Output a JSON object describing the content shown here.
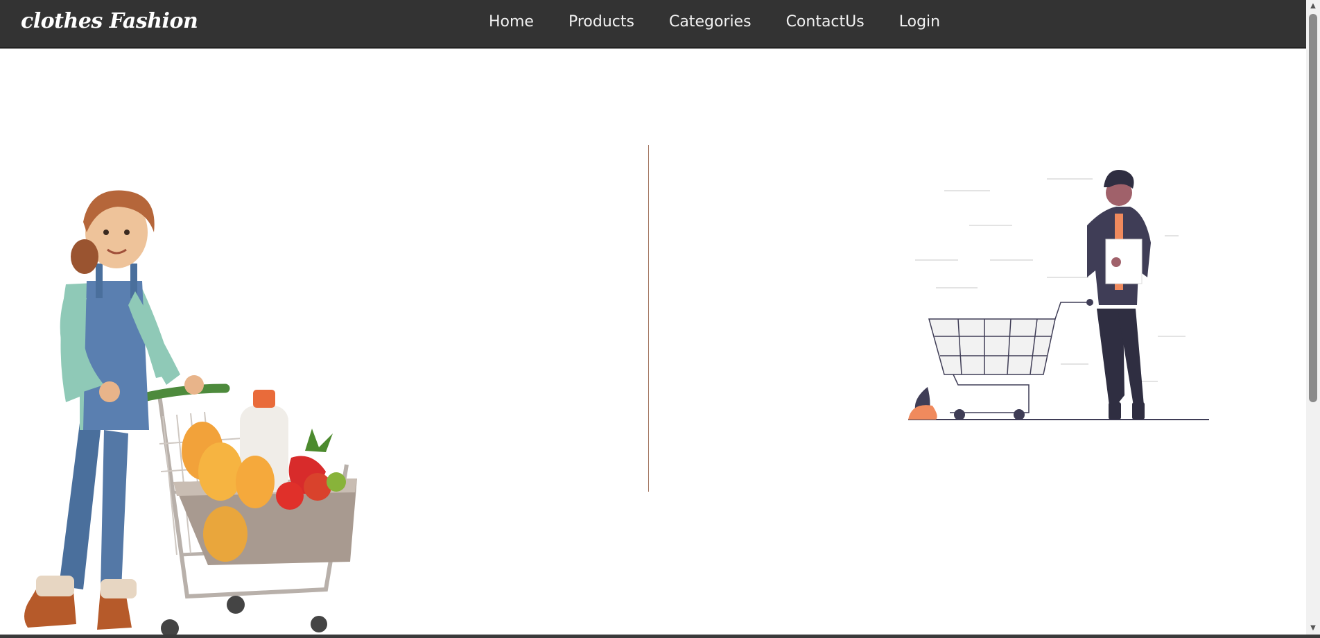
{
  "navbar": {
    "brand": "clothes Fashion",
    "links": [
      {
        "label": "Home"
      },
      {
        "label": "Products"
      },
      {
        "label": "Categories"
      },
      {
        "label": "ContactUs"
      },
      {
        "label": "Login"
      }
    ]
  },
  "colors": {
    "navbar_bg": "#333333",
    "divider": "#a0705a",
    "accent_orange": "#f08a5d",
    "illustration_dark": "#3f3d56"
  },
  "icons": {
    "scroll_up": "scroll-up-arrow-icon",
    "scroll_down": "scroll-down-arrow-icon"
  }
}
